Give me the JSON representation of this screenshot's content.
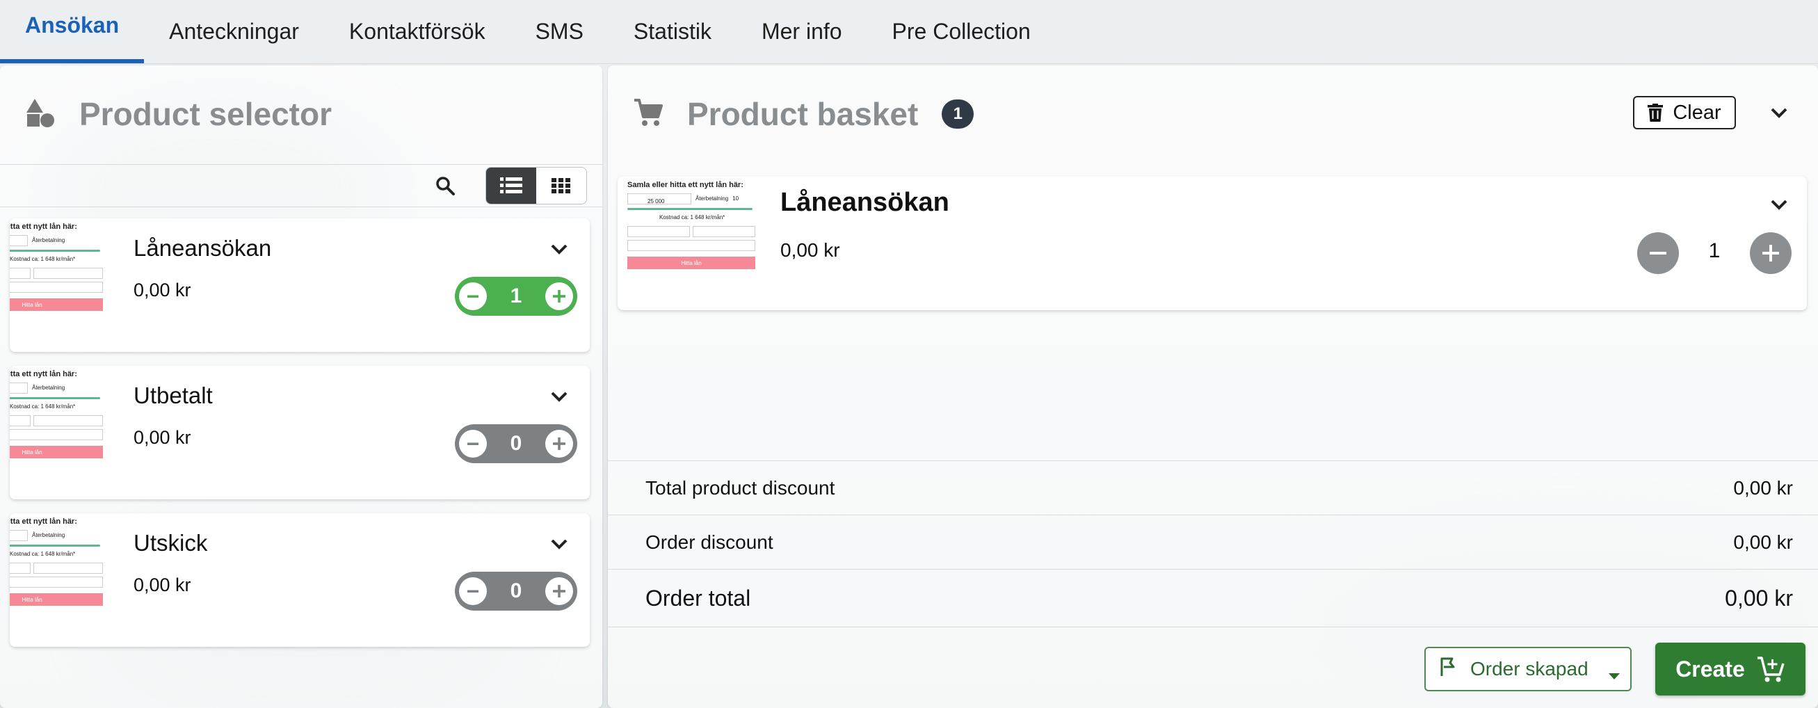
{
  "tabs": [
    {
      "label": "Ansökan",
      "active": true
    },
    {
      "label": "Anteckningar"
    },
    {
      "label": "Kontaktförsök"
    },
    {
      "label": "SMS"
    },
    {
      "label": "Statistik"
    },
    {
      "label": "Mer info"
    },
    {
      "label": "Pre Collection"
    }
  ],
  "selector": {
    "title": "Product selector",
    "products": [
      {
        "name": "Låneansökan",
        "price": "0,00 kr",
        "qty": "1",
        "selected": true
      },
      {
        "name": "Utbetalt",
        "price": "0,00 kr",
        "qty": "0",
        "selected": false
      },
      {
        "name": "Utskick",
        "price": "0,00 kr",
        "qty": "0",
        "selected": false
      }
    ]
  },
  "thumbnail": {
    "heading": "Samla eller hitta ett nytt lån här:",
    "amount": "25 000",
    "term_label": "Återbetalning",
    "term_value": "10",
    "cost_line": "Kostnad ca: 1 648 kr/mån*",
    "submit": "Hitta lån"
  },
  "basket": {
    "title": "Product basket",
    "count": "1",
    "clear_label": "Clear",
    "items": [
      {
        "name": "Låneansökan",
        "price": "0,00 kr",
        "qty": "1"
      }
    ],
    "summary": {
      "product_discount_label": "Total product discount",
      "product_discount_value": "0,00 kr",
      "order_discount_label": "Order discount",
      "order_discount_value": "0,00 kr",
      "order_total_label": "Order total",
      "order_total_value": "0,00 kr"
    },
    "status_label": "Order skapad",
    "create_label": "Create"
  },
  "colors": {
    "accent": "#1a62b8",
    "stepper_on": "#4caf50",
    "stepper_off": "#7e8183",
    "create": "#2e7d32",
    "badge": "#2f3a46"
  }
}
